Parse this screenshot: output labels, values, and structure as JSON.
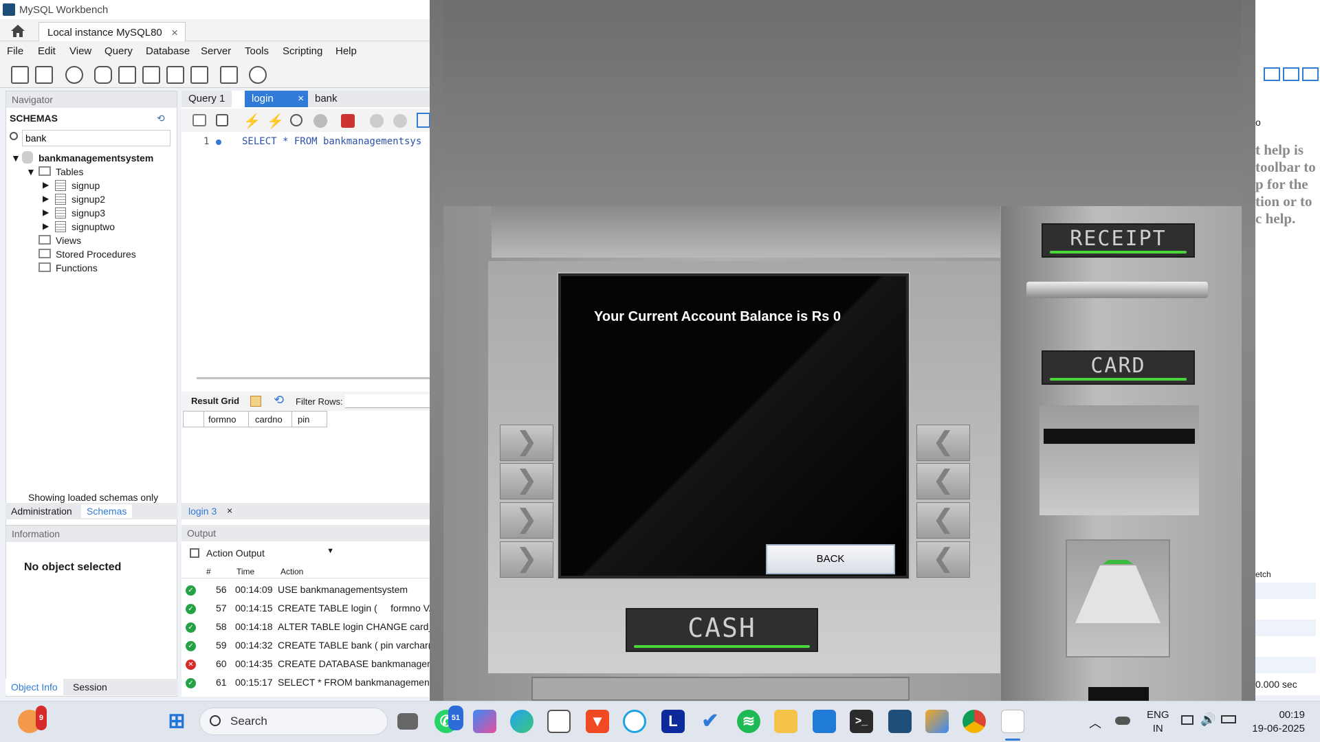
{
  "window": {
    "title": "MySQL Workbench"
  },
  "connection_tab": {
    "label": "Local instance MySQL80",
    "close": "×"
  },
  "menu": [
    "File",
    "Edit",
    "View",
    "Query",
    "Database",
    "Server",
    "Tools",
    "Scripting",
    "Help"
  ],
  "navigator": {
    "header": "Navigator",
    "schemas_label": "SCHEMAS",
    "search_value": "bank",
    "schema": "bankmanagementsystem",
    "tables_label": "Tables",
    "tables": [
      "signup",
      "signup2",
      "signup3",
      "signuptwo"
    ],
    "views": "Views",
    "procedures": "Stored Procedures",
    "functions": "Functions",
    "status": "Showing loaded schemas only",
    "tabs": {
      "admin": "Administration",
      "schemas": "Schemas"
    }
  },
  "information": {
    "header": "Information",
    "message": "No object selected",
    "tabs": {
      "object_info": "Object Info",
      "session": "Session"
    }
  },
  "query_tabs": [
    {
      "label": "Query 1"
    },
    {
      "label": "login",
      "close": "×"
    },
    {
      "label": "bank"
    }
  ],
  "editor": {
    "line": "1",
    "sql": "SELECT * FROM bankmanagementsys"
  },
  "result": {
    "grid_label": "Result Grid",
    "filter_label": "Filter Rows:",
    "columns": [
      "formno",
      "cardno",
      "pin"
    ],
    "tab": "login 3",
    "tab_close": "×"
  },
  "output": {
    "header": "Output",
    "selector": "Action Output",
    "columns": {
      "num": "#",
      "time": "Time",
      "action": "Action"
    },
    "rows": [
      {
        "n": "56",
        "time": "00:14:09",
        "action": "USE bankmanagementsystem",
        "status": "ok"
      },
      {
        "n": "57",
        "time": "00:14:15",
        "action": "CREATE TABLE login (     formno VA",
        "status": "ok"
      },
      {
        "n": "58",
        "time": "00:14:18",
        "action": "ALTER TABLE login CHANGE card_",
        "status": "ok"
      },
      {
        "n": "59",
        "time": "00:14:32",
        "action": "CREATE TABLE bank ( pin varchar(1",
        "status": "ok"
      },
      {
        "n": "60",
        "time": "00:14:35",
        "action": "CREATE DATABASE bankmanagem",
        "status": "error"
      },
      {
        "n": "61",
        "time": "00:15:17",
        "action": "SELECT * FROM bankmanagements",
        "status": "ok"
      }
    ],
    "fetch_label": "etch",
    "duration": "0.000 sec"
  },
  "help_text": [
    "t help is",
    "toolbar to",
    "p for the",
    "tion or to",
    "c help."
  ],
  "right_partial": "o",
  "atm": {
    "balance_text": "Your Current Account Balance is Rs 0",
    "back_label": "BACK",
    "receipt_label": "RECEIPT",
    "card_label": "CARD",
    "cash_label": "CASH",
    "left_arrow": "❯",
    "right_arrow": "❮"
  },
  "taskbar": {
    "search_placeholder": "Search",
    "whatsapp_badge": "51",
    "weather_badge": "9",
    "language_top": "ENG",
    "language_bottom": "IN",
    "time": "00:19",
    "date": "19-06-2025",
    "app_letter_l": "L"
  },
  "colors": {
    "accent": "#2f7bd6",
    "atm_green": "#4ad63a",
    "ok_green": "#25a244",
    "err_red": "#d62b2b"
  }
}
